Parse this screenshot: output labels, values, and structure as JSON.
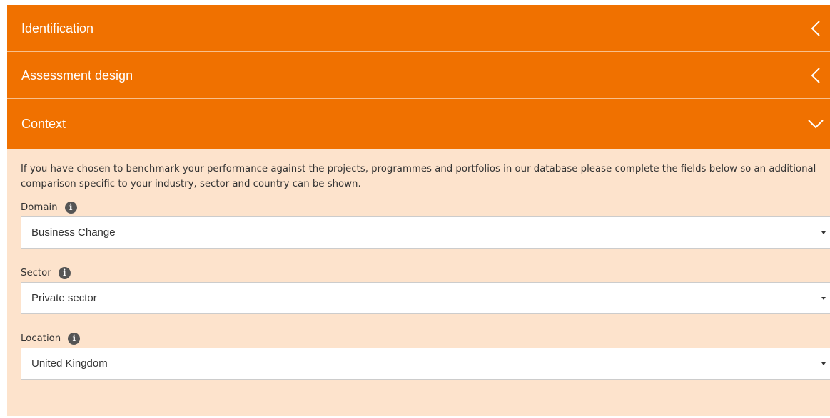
{
  "accordion": {
    "sections": [
      {
        "title": "Identification",
        "state": "collapsed",
        "icon": "chevron-left-icon"
      },
      {
        "title": "Assessment design",
        "state": "collapsed",
        "icon": "chevron-left-icon"
      },
      {
        "title": "Context",
        "state": "expanded",
        "icon": "chevron-down-icon"
      }
    ]
  },
  "context": {
    "intro": "If you have chosen to benchmark your performance against the projects, programmes and portfolios in our database please complete the fields below so an additional comparison specific to your industry, sector and country can be shown.",
    "fields": [
      {
        "label": "Domain",
        "value": "Business Change",
        "icon": "info-icon"
      },
      {
        "label": "Sector",
        "value": "Private sector",
        "icon": "info-icon"
      },
      {
        "label": "Location",
        "value": "United Kingdom",
        "icon": "info-icon"
      }
    ]
  },
  "colors": {
    "header_bg": "#f07100",
    "panel_bg": "#fde3cc",
    "text": "#333333"
  }
}
